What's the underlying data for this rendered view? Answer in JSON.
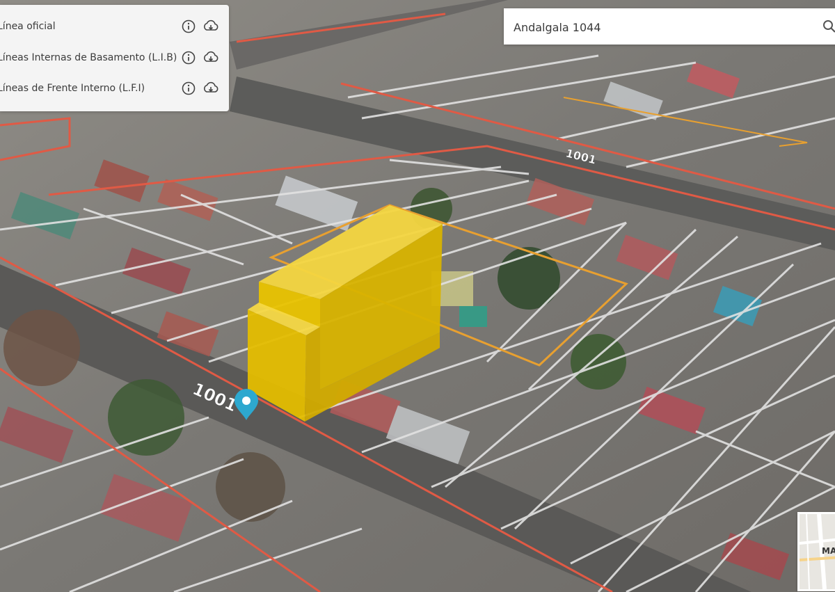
{
  "layers": [
    {
      "label": "Línea oficial"
    },
    {
      "label": "Líneas Internas de Basamento (L.I.B)"
    },
    {
      "label": "Líneas de Frente Interno (L.F.I)"
    }
  ],
  "search": {
    "value": "Andalgala 1044"
  },
  "street_numbers": {
    "main": "1001",
    "top": "1001"
  },
  "minimap": {
    "label": "MA"
  },
  "colors": {
    "building": "#f2c700",
    "parcel_outline": "#e8a030",
    "street_line": "#e05a45",
    "lot_lines": "#e2e2e2",
    "pin": "#2da8cf"
  }
}
